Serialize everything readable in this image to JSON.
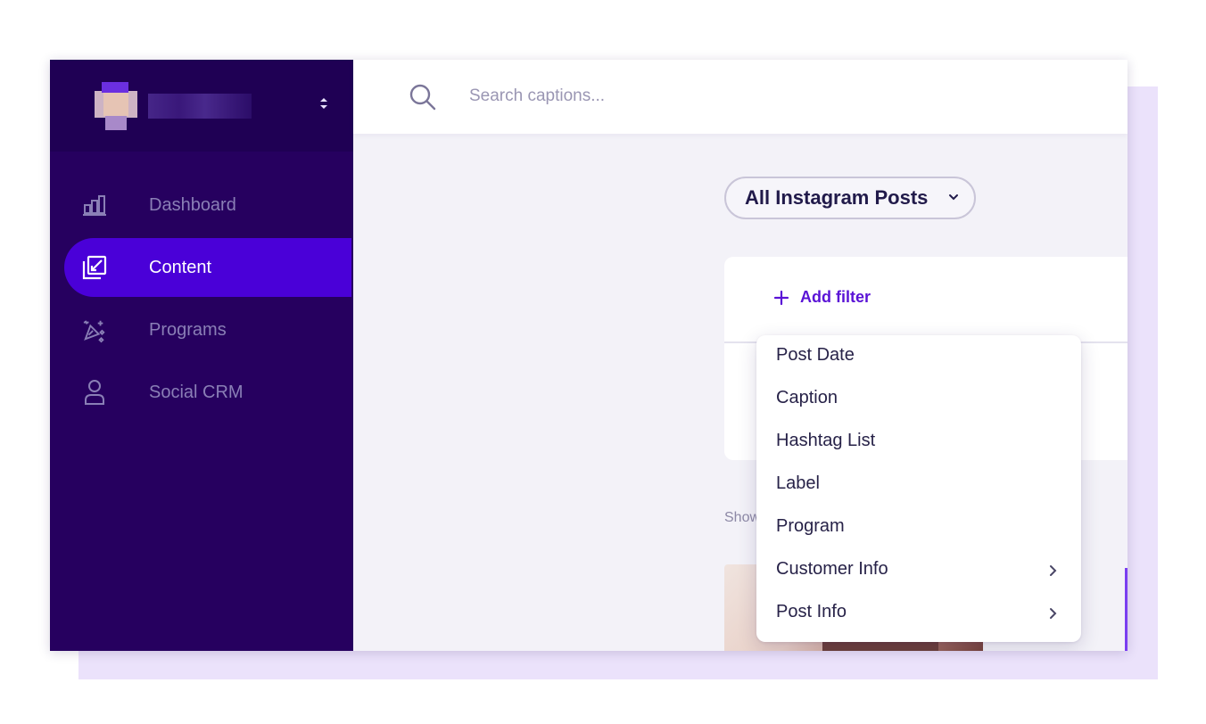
{
  "search": {
    "placeholder": "Search captions..."
  },
  "sidebar": {
    "items": [
      {
        "label": "Dashboard",
        "icon": "bar-chart-icon",
        "active": false
      },
      {
        "label": "Content",
        "icon": "gallery-edit-icon",
        "active": true
      },
      {
        "label": "Programs",
        "icon": "sparkle-wand-icon",
        "active": false
      },
      {
        "label": "Social CRM",
        "icon": "person-icon",
        "active": false
      }
    ]
  },
  "main": {
    "view_selector": "All Instagram Posts",
    "add_filter_label": "Add filter",
    "showing_text": "Show"
  },
  "filter_menu": {
    "items": [
      {
        "label": "Post Date",
        "has_submenu": false
      },
      {
        "label": "Caption",
        "has_submenu": false
      },
      {
        "label": "Hashtag List",
        "has_submenu": false
      },
      {
        "label": "Label",
        "has_submenu": false
      },
      {
        "label": "Program",
        "has_submenu": false
      },
      {
        "label": "Customer Info",
        "has_submenu": true
      },
      {
        "label": "Post Info",
        "has_submenu": true
      }
    ]
  },
  "colors": {
    "sidebar_bg": "#26005f",
    "active_nav": "#4a00d8",
    "accent": "#5a13d6",
    "backdrop": "#ebe2fb"
  }
}
